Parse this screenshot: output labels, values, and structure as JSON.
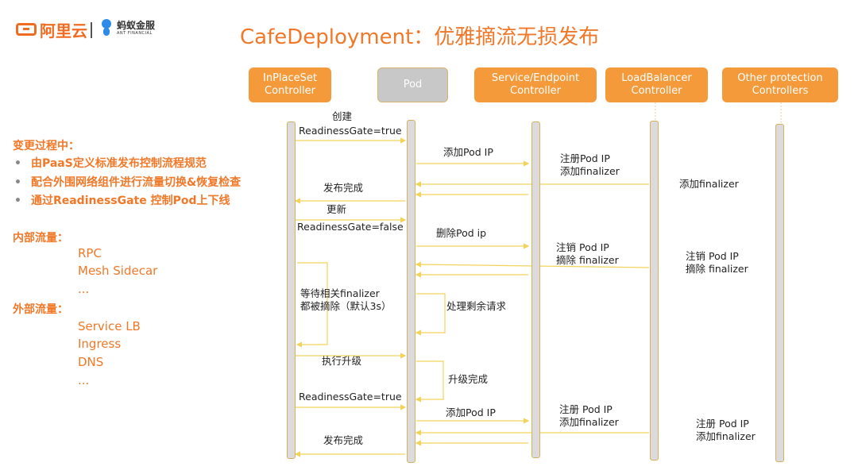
{
  "branding": {
    "aliyun_label": "阿里云",
    "ant_label_cn": "蚂蚁金服",
    "ant_label_en": "ANT FINANCIAL"
  },
  "title": "CafeDeployment：优雅摘流无损发布",
  "left_panel": {
    "section1_heading": "变更过程中：",
    "section1_items": [
      "由PaaS定义标准发布控制流程规范",
      "配合外围网络组件进行流量切换&恢复检查",
      "通过ReadinessGate 控制Pod上下线"
    ],
    "internal_heading": "内部流量：",
    "internal_items": [
      "RPC",
      "Mesh Sidecar",
      "..."
    ],
    "external_heading": "外部流量：",
    "external_items": [
      "Service LB",
      "Ingress",
      "DNS",
      "..."
    ]
  },
  "participants": [
    {
      "line1": "InPlaceSet",
      "line2": "Controller"
    },
    {
      "line1": "Pod",
      "line2": ""
    },
    {
      "line1": "Service/Endpoint",
      "line2": "Controller"
    },
    {
      "line1": "LoadBalancer",
      "line2": "Controller"
    },
    {
      "line1": "Other protection",
      "line2": "Controllers"
    }
  ],
  "messages": {
    "create": "创建",
    "rg_true_1": "ReadinessGate=true",
    "add_pod_ip_1": "添加Pod IP",
    "svc_register_1a": "注册Pod IP",
    "svc_register_1b": "添加finalizer",
    "lb_add_finalizer": "添加finalizer",
    "publish_done_1": "发布完成",
    "update": "更新",
    "rg_false": "ReadinessGate=false",
    "delete_pod_ip": "删除Pod ip",
    "svc_unregister_a": "注销 Pod IP",
    "svc_unregister_b": "摘除 finalizer",
    "other_unregister_a": "注销 Pod IP",
    "other_unregister_b": "摘除 finalizer",
    "wait_finalizer_a": "等待相关finalizer",
    "wait_finalizer_b": "都被摘除（默认3s）",
    "process_remaining": "处理剩余请求",
    "do_upgrade": "执行升级",
    "upgrade_done": "升级完成",
    "rg_true_2": "ReadinessGate=true",
    "add_pod_ip_2": "添加Pod IP",
    "svc_register_2a": "注册 Pod IP",
    "svc_register_2b": "添加finalizer",
    "other_register_a": "注册 Pod IP",
    "other_register_b": "添加finalizer",
    "publish_done_2": "发布完成"
  },
  "colors": {
    "accent": "#f07828",
    "header_fill": "#f59a3a",
    "pod_fill": "#c8c8c8",
    "lifeline_border": "#d2b25e",
    "arrow": "#f2d35a"
  }
}
